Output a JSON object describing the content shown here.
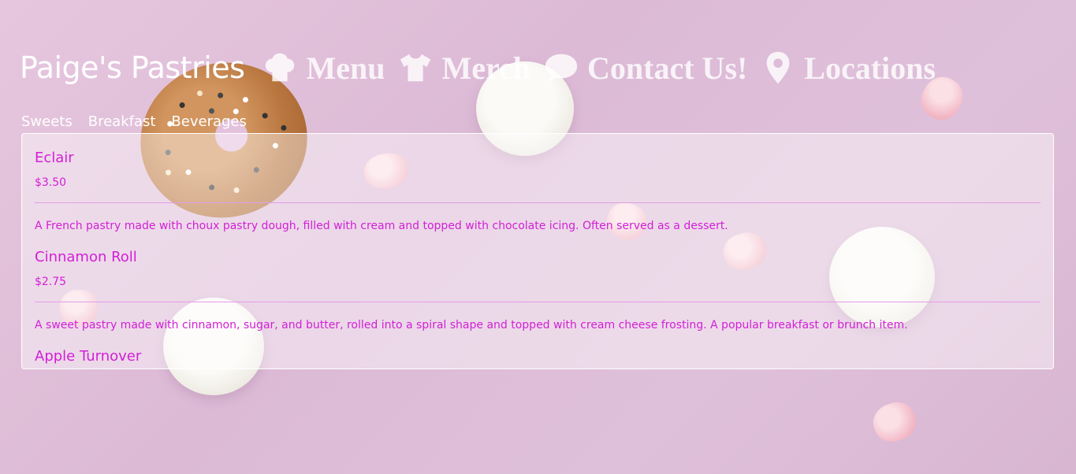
{
  "header": {
    "brand": "Paige's Pastries",
    "nav": [
      {
        "label": "Menu",
        "icon": "chef-hat-icon"
      },
      {
        "label": "Merch",
        "icon": "tshirt-icon"
      },
      {
        "label": "Contact Us!",
        "icon": "speech-bubble-icon"
      },
      {
        "label": "Locations",
        "icon": "map-pin-icon"
      }
    ]
  },
  "tabs": [
    "Sweets",
    "Breakfast",
    "Beverages"
  ],
  "menu": {
    "items": [
      {
        "name": "Eclair",
        "price": "$3.50",
        "description": "A French pastry made with choux pastry dough, filled with cream and topped with chocolate icing. Often served as a dessert."
      },
      {
        "name": "Cinnamon Roll",
        "price": "$2.75",
        "description": "A sweet pastry made with cinnamon, sugar, and butter, rolled into a spiral shape and topped with cream cheese frosting. A popular breakfast or brunch item."
      },
      {
        "name": "Apple Turnover"
      }
    ]
  },
  "colors": {
    "accent": "#d21fd6",
    "background": "#e2c3dc",
    "nav_text": "#ffffff"
  }
}
